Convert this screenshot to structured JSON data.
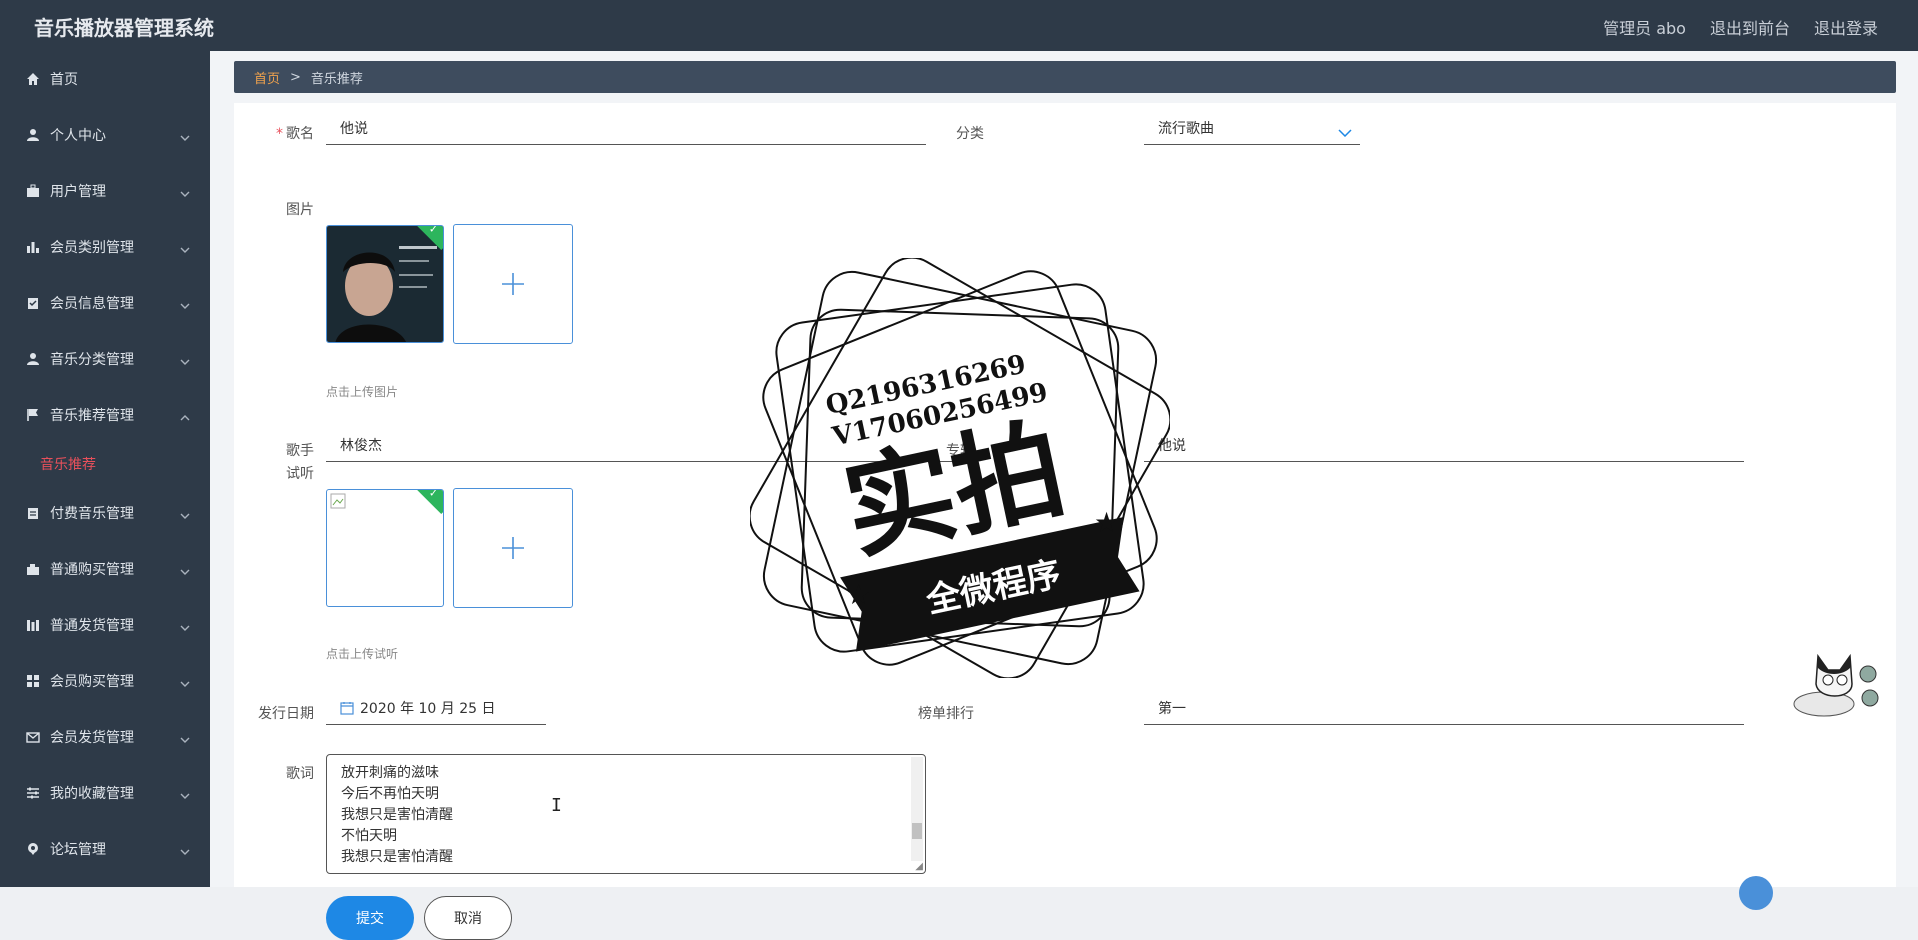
{
  "app": {
    "title": "音乐播放器管理系统"
  },
  "header": {
    "user": "管理员 abo",
    "back_front": "退出到前台",
    "logout": "退出登录"
  },
  "sidebar": {
    "items": [
      {
        "label": "首页",
        "icon": "home-icon"
      },
      {
        "label": "个人中心",
        "icon": "user-icon"
      },
      {
        "label": "用户管理",
        "icon": "briefcase-icon"
      },
      {
        "label": "会员类别管理",
        "icon": "bar-chart-icon"
      },
      {
        "label": "会员信息管理",
        "icon": "clipboard-icon"
      },
      {
        "label": "音乐分类管理",
        "icon": "user-icon"
      },
      {
        "label": "音乐推荐管理",
        "icon": "flag-icon",
        "expanded": true
      },
      {
        "label": "付费音乐管理",
        "icon": "clipboard-icon"
      },
      {
        "label": "普通购买管理",
        "icon": "cart-icon"
      },
      {
        "label": "普通发货管理",
        "icon": "ship-icon"
      },
      {
        "label": "会员购买管理",
        "icon": "grid-icon"
      },
      {
        "label": "会员发货管理",
        "icon": "mail-icon"
      },
      {
        "label": "我的收藏管理",
        "icon": "sliders-icon"
      },
      {
        "label": "论坛管理",
        "icon": "pin-icon"
      }
    ],
    "subitem": "音乐推荐"
  },
  "breadcrumb": {
    "home": "首页",
    "sep": ">",
    "current": "音乐推荐"
  },
  "form": {
    "song_label": "歌名",
    "song_value": "他说",
    "category_label": "分类",
    "category_value": "流行歌曲",
    "image_label": "图片",
    "image_hint": "点击上传图片",
    "singer_label": "歌手",
    "singer_value": "林俊杰",
    "album_label": "专辑",
    "album_value": "他说",
    "audition_label": "试听",
    "audition_hint": "点击上传试听",
    "date_label": "发行日期",
    "date_value": "2020 年 10 月 25 日",
    "rank_label": "榜单排行",
    "rank_value": "第一",
    "lyrics_label": "歌词",
    "lyrics": [
      "放开刺痛的滋味",
      "今后不再怕天明",
      "我想只是害怕清醒",
      "不怕天明",
      "我想只是害怕清醒"
    ],
    "submit": "提交",
    "cancel": "取消"
  },
  "watermark": {
    "line1": "Q2196316269",
    "line2": "V17060256499",
    "big": "实拍",
    "ribbon": "全微程序"
  },
  "colors": {
    "sidebar_bg": "#2e3a48",
    "accent_red": "#e8505b",
    "primary": "#1e88e5",
    "breadcrumb_home": "#f0a24d"
  }
}
